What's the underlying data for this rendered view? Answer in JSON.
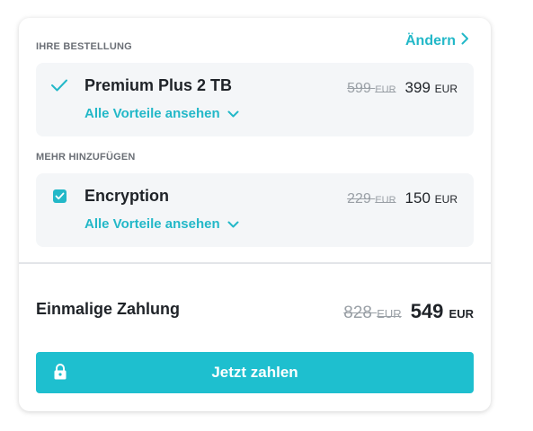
{
  "order": {
    "section_label": "IHRE BESTELLUNG",
    "change_label": "Ändern",
    "item": {
      "name": "Premium Plus 2 TB",
      "old_price": "599",
      "old_currency": "EUR",
      "price": "399",
      "currency": "EUR",
      "benefits_link": "Alle Vorteile ansehen",
      "selected": true
    }
  },
  "addons": {
    "section_label": "MEHR HINZUFÜGEN",
    "item": {
      "name": "Encryption",
      "old_price": "229",
      "old_currency": "EUR",
      "price": "150",
      "currency": "EUR",
      "benefits_link": "Alle Vorteile ansehen",
      "checked": true
    }
  },
  "total": {
    "label": "Einmalige Zahlung",
    "old_price": "828",
    "old_currency": "EUR",
    "price": "549",
    "currency": "EUR"
  },
  "pay_button": {
    "label": "Jetzt zahlen",
    "icon": "lock-icon"
  },
  "colors": {
    "accent": "#23b8c8",
    "button": "#1ebfcf",
    "item_background": "#f4f6f8",
    "text": "#1f2328",
    "muted": "#9aa0a6"
  }
}
